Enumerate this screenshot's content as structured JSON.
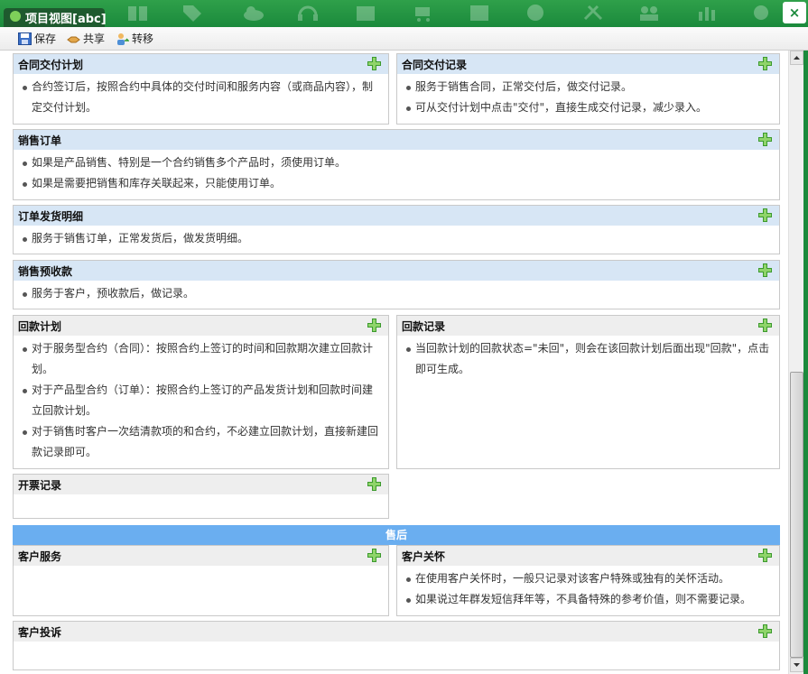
{
  "window": {
    "title": "项目视图[abc]",
    "close_label": "×"
  },
  "toolbar": {
    "save_label": "保存",
    "share_label": "共享",
    "transfer_label": "转移"
  },
  "panels": {
    "contract_delivery_plan": {
      "title": "合同交付计划",
      "items": [
        "合约签订后，按照合约中具体的交付时间和服务内容（或商品内容），制",
        "定交付计划。"
      ]
    },
    "contract_delivery_record": {
      "title": "合同交付记录",
      "items": [
        "服务于销售合同，正常交付后，做交付记录。",
        "可从交付计划中点击\"交付\"，直接生成交付记录，减少录入。"
      ]
    },
    "sales_order": {
      "title": "销售订单",
      "items": [
        "如果是产品销售、特别是一个合约销售多个产品时，须使用订单。",
        "如果是需要把销售和库存关联起来，只能使用订单。"
      ]
    },
    "order_shipping": {
      "title": "订单发货明细",
      "items": [
        "服务于销售订单，正常发货后，做发货明细。"
      ]
    },
    "sales_prepayment": {
      "title": "销售预收款",
      "items": [
        "服务于客户，预收款后，做记录。"
      ]
    },
    "payment_plan": {
      "title": "回款计划",
      "items": [
        "对于服务型合约（合同）：按照合约上签订的时间和回款期次建立回款计",
        "划。",
        "对于产品型合约（订单）：按照合约上签订的产品发货计划和回款时间建",
        "立回款计划。",
        "对于销售时客户一次结清款项的和合约，不必建立回款计划，直接新建回",
        "款记录即可。"
      ]
    },
    "payment_record": {
      "title": "回款记录",
      "items": [
        "当回款计划的回款状态=\"未回\"，则会在该回款计划后面出现\"回款\"，点击",
        "即可生成。"
      ]
    },
    "invoice_record": {
      "title": "开票记录"
    },
    "after_sales_bar": "售后",
    "customer_service": {
      "title": "客户服务"
    },
    "customer_care": {
      "title": "客户关怀",
      "items": [
        "在使用客户关怀时，一般只记录对该客户特殊或独有的关怀活动。",
        "如果说过年群发短信拜年等，不具备特殊的参考价值，则不需要记录。"
      ]
    },
    "customer_complaint": {
      "title": "客户投诉"
    }
  },
  "colors": {
    "titlebar": "#1b8a3c",
    "panel_header": "#d7e6f5",
    "section_bar": "#6aaef0",
    "add_icon": "#3c9a2e"
  }
}
